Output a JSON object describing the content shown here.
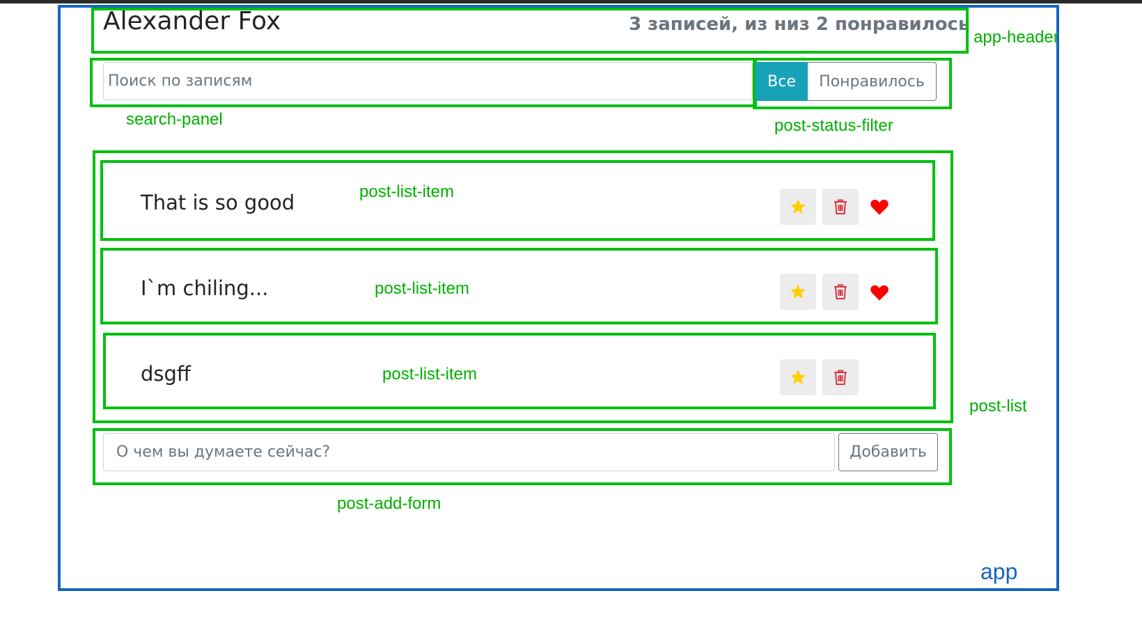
{
  "app_header": {
    "title": "Alexander Fox",
    "counter": "3 записей, из низ 2 понравилось"
  },
  "search_panel": {
    "placeholder": "Поиск по записям"
  },
  "post_status_filter": {
    "buttons": [
      {
        "label": "Все",
        "active": true
      },
      {
        "label": "Понравилось",
        "active": false
      }
    ]
  },
  "post_list": {
    "items": [
      {
        "text": "That is so good",
        "liked": true
      },
      {
        "text": "I`m chiling...",
        "liked": true
      },
      {
        "text": "dsgff",
        "liked": false
      }
    ]
  },
  "post_add_form": {
    "placeholder": "О чем вы думаете сейчас?",
    "button_label": "Добавить"
  },
  "annotations": {
    "app": "app",
    "app_header": "app-header",
    "search_panel": "search-panel",
    "post_status_filter": "post-status-filter",
    "post_list": "post-list",
    "post_list_item": "post-list-item",
    "post_add_form": "post-add-form"
  },
  "colors": {
    "annotation_green": "#00c010",
    "annotation_blue": "#1565c0",
    "active_filter": "#17a2b8",
    "star": "#ffd000",
    "trash": "#dc3545",
    "heart": "#ff0000"
  },
  "icons": {
    "star": "star-icon",
    "trash": "trash-icon",
    "heart": "heart-icon"
  }
}
